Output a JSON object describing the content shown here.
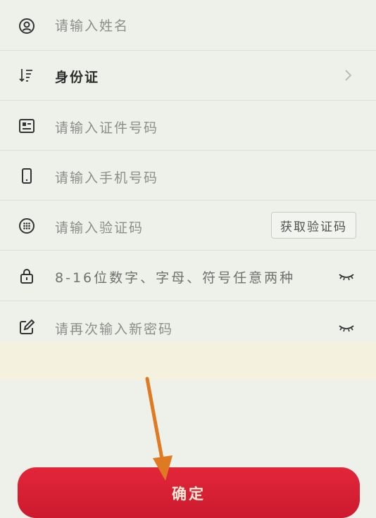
{
  "form": {
    "name_placeholder": "请输入姓名",
    "id_type_value": "身份证",
    "id_number_placeholder": "请输入证件号码",
    "phone_placeholder": "请输入手机号码",
    "code_placeholder": "请输入验证码",
    "get_code_label": "获取验证码",
    "password_hint": "8-16位数字、字母、符号任意两种",
    "confirm_password_placeholder": "请再次输入新密码"
  },
  "confirm_label": "确定",
  "icons": {
    "name": "person-icon",
    "id_type": "sort-icon",
    "id_number": "id-card-icon",
    "phone": "phone-icon",
    "code": "keypad-icon",
    "password": "lock-icon",
    "confirm_password": "edit-icon",
    "dropdown": "chevron-right-icon",
    "visibility": "eye-closed-icon"
  },
  "colors": {
    "confirm_button": "#cc1a2e",
    "annotation_arrow": "#e07a22"
  }
}
